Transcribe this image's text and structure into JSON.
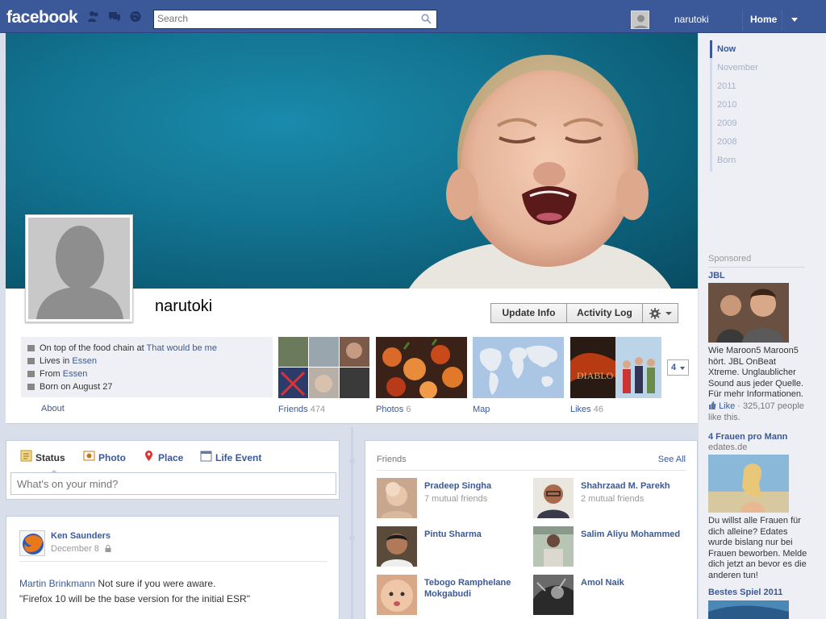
{
  "topbar": {
    "logo": "facebook",
    "search_placeholder": "Search",
    "user_name": "narutoki",
    "home_label": "Home"
  },
  "profile": {
    "name": "narutoki",
    "buttons": {
      "update_info": "Update Info",
      "activity_log": "Activity Log"
    },
    "info": {
      "work_prefix": "On top of the food chain at ",
      "work_link": "That would be me",
      "lives_prefix": "Lives in ",
      "lives_link": "Essen",
      "from_prefix": "From ",
      "from_link": "Essen",
      "born": "Born on August 27"
    },
    "about_label": "About",
    "thumbs": [
      {
        "label": "Friends",
        "count": "474"
      },
      {
        "label": "Photos",
        "count": "6"
      },
      {
        "label": "Map",
        "count": ""
      },
      {
        "label": "Likes",
        "count": "46"
      }
    ],
    "more_count": "4"
  },
  "composer": {
    "tabs": [
      "Status",
      "Photo",
      "Place",
      "Life Event"
    ],
    "placeholder": "What's on your mind?"
  },
  "post": {
    "author": "Ken Saunders",
    "date": "December 8",
    "mention": "Martin Brinkmann",
    "text_line1": " Not sure if you were aware.",
    "text_line2": "\"Firefox 10 will be the base version for the initial ESR\""
  },
  "friends": {
    "title": "Friends",
    "see_all": "See All",
    "items": [
      {
        "name": "Pradeep Singha",
        "mutual": "7 mutual friends"
      },
      {
        "name": "Shahrzaad M. Parekh",
        "mutual": "2 mutual friends"
      },
      {
        "name": "Pintu Sharma",
        "mutual": ""
      },
      {
        "name": "Salim Aliyu Mohammed",
        "mutual": ""
      },
      {
        "name": "Tebogo Ramphelane Mokgabudi",
        "mutual": ""
      },
      {
        "name": "Amol Naik",
        "mutual": ""
      }
    ]
  },
  "timeline_nav": [
    "Now",
    "November",
    "2011",
    "2010",
    "2009",
    "2008",
    "Born"
  ],
  "sidebar": {
    "sponsored_label": "Sponsored",
    "ads": [
      {
        "title": "JBL",
        "subtitle": "",
        "text": "Wie Maroon5 Maroon5 hört. JBL OnBeat Xtreme. Unglaublicher Sound aus jeder Quelle. Für mehr Informationen.",
        "like_label": "Like",
        "like_text": " · 325,107 people like this."
      },
      {
        "title": "4 Frauen pro Mann",
        "subtitle": "edates.de",
        "text": "Du willst alle Frauen für dich alleine? Edates wurde bislang nur bei Frauen beworben. Melde dich jetzt an bevor es die anderen tun!"
      },
      {
        "title": "Bestes Spiel 2011"
      }
    ]
  },
  "colors": {
    "brand": "#3b5998",
    "cover": "#137592",
    "rail": "#edeff4"
  }
}
